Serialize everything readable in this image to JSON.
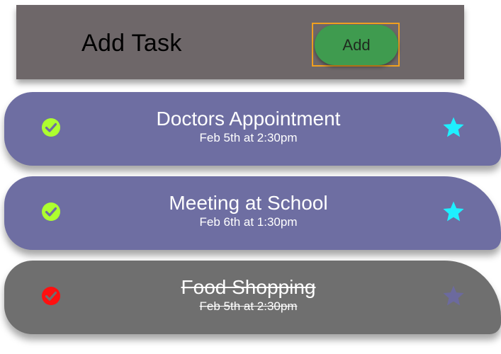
{
  "header": {
    "title": "Add Task",
    "add_label": "Add"
  },
  "tasks": [
    {
      "title": "Doctors Appointment",
      "time": "Feb 5th at 2:30pm",
      "completed": false,
      "starred": true,
      "check_color": "#adff2f",
      "star_color": "#1ef0ff"
    },
    {
      "title": "Meeting at School",
      "time": "Feb 6th at 1:30pm",
      "completed": false,
      "starred": true,
      "check_color": "#adff2f",
      "star_color": "#1ef0ff"
    },
    {
      "title": "Food Shopping",
      "time": "Feb 5th at 2:30pm",
      "completed": true,
      "starred": false,
      "check_color": "#ff1010",
      "star_color": "#6c6a9e"
    }
  ],
  "colors": {
    "header_bg": "#6e6769",
    "add_button": "#3f9b4f",
    "active_task_bg": "#6e6ea2",
    "done_task_bg": "#6f6f6f"
  }
}
